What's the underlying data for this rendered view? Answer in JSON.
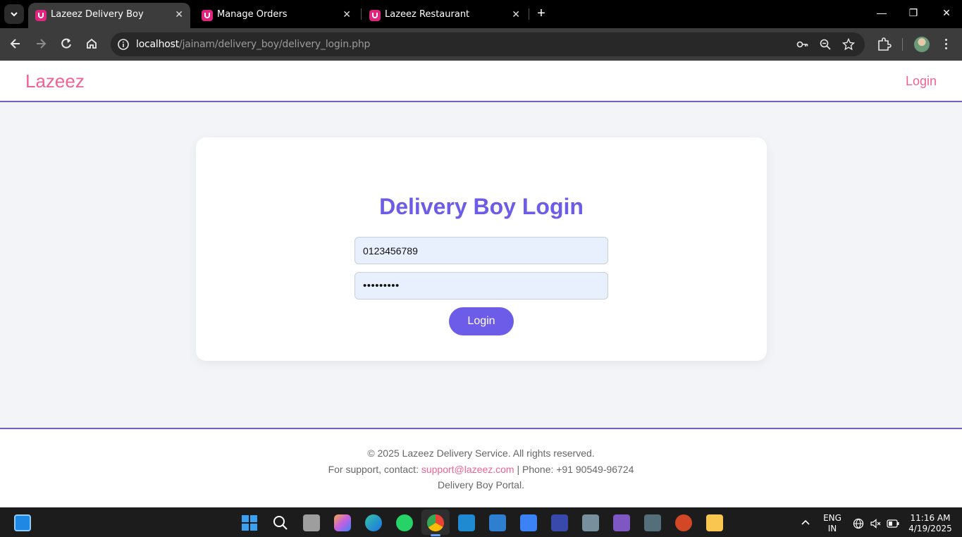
{
  "browser": {
    "tabs": [
      {
        "title": "Lazeez Delivery Boy",
        "active": true
      },
      {
        "title": "Manage Orders",
        "active": false
      },
      {
        "title": "Lazeez Restaurant",
        "active": false
      }
    ],
    "url_host": "localhost",
    "url_path": "/jainam/delivery_boy/delivery_login.php"
  },
  "header": {
    "brand": "Lazeez",
    "login_link": "Login"
  },
  "login": {
    "title": "Delivery Boy Login",
    "phone_value": "0123456789",
    "password_value": "password1",
    "button": "Login"
  },
  "footer": {
    "copyright": "© 2025 Lazeez Delivery Service. All rights reserved.",
    "support_prefix": "For support, contact:",
    "support_email": "support@lazeez.com",
    "phone": "| Phone: +91 90549-96724",
    "portal": "Delivery Boy Portal."
  },
  "taskbar": {
    "lang_line1": "ENG",
    "lang_line2": "IN",
    "time": "11:16 AM",
    "date": "4/19/2025"
  },
  "colors": {
    "accent": "#6c5ce7",
    "brand_pink": "#f06292"
  }
}
